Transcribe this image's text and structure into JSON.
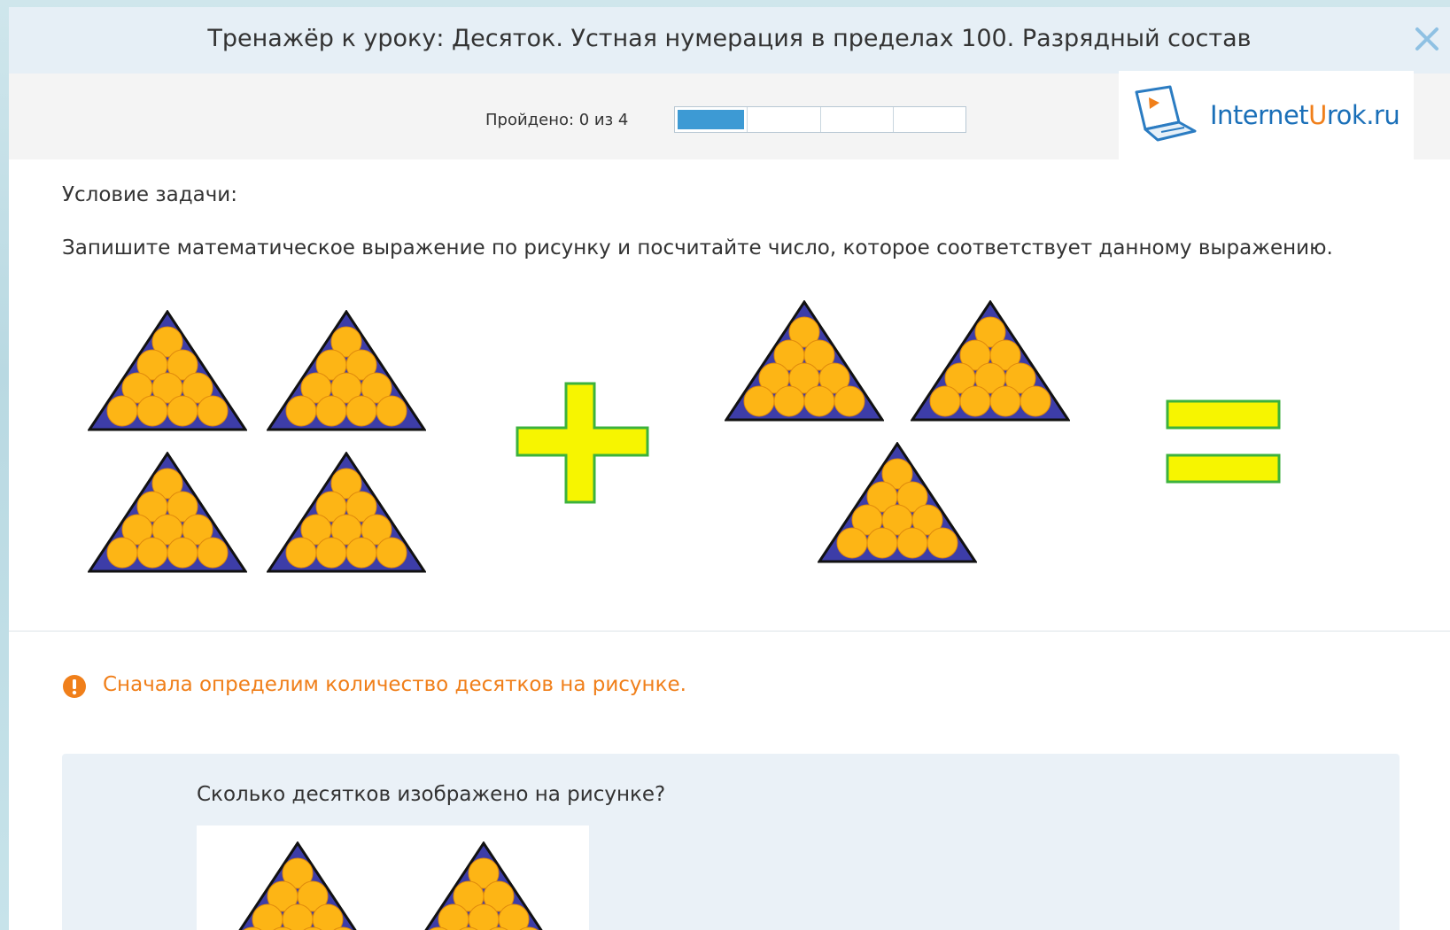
{
  "window": {
    "title": "Тренажёр к уроку: Десяток. Устная нумерация в пределах 100. Разрядный состав",
    "close_icon": "close-icon"
  },
  "progress": {
    "label": "Пройдено: 0 из 4",
    "segments_total": 4,
    "segments_filled": 1,
    "fill_color": "#3d9ad4"
  },
  "logo": {
    "text_part1": "Internet",
    "text_part2": "U",
    "text_part3": "rok.ru",
    "icon": "laptop-play-icon"
  },
  "task": {
    "condition_title": "Условие задачи:",
    "condition_text": "Запишите математическое выражение по рисунку и посчитайте число, которое соответствует данному выражению.",
    "picture": {
      "left_group_triangles": 4,
      "right_group_triangles": 3,
      "plus_icon": "plus-sign-icon",
      "equals_icon": "equals-sign-icon",
      "triangle_icon": "ten-balls-triangle-icon",
      "triangle_color": "#3d3da8",
      "ball_color": "#fdb515",
      "sign_color": "#f7f500",
      "sign_border_color": "#3cb23c"
    }
  },
  "hint": {
    "icon": "warning-icon",
    "text": "Сначала определим количество десятков на рисунке.",
    "color": "#f07f1a"
  },
  "question": {
    "text": "Сколько десятков изображено на рисунке?",
    "image_triangles_visible": 2
  }
}
